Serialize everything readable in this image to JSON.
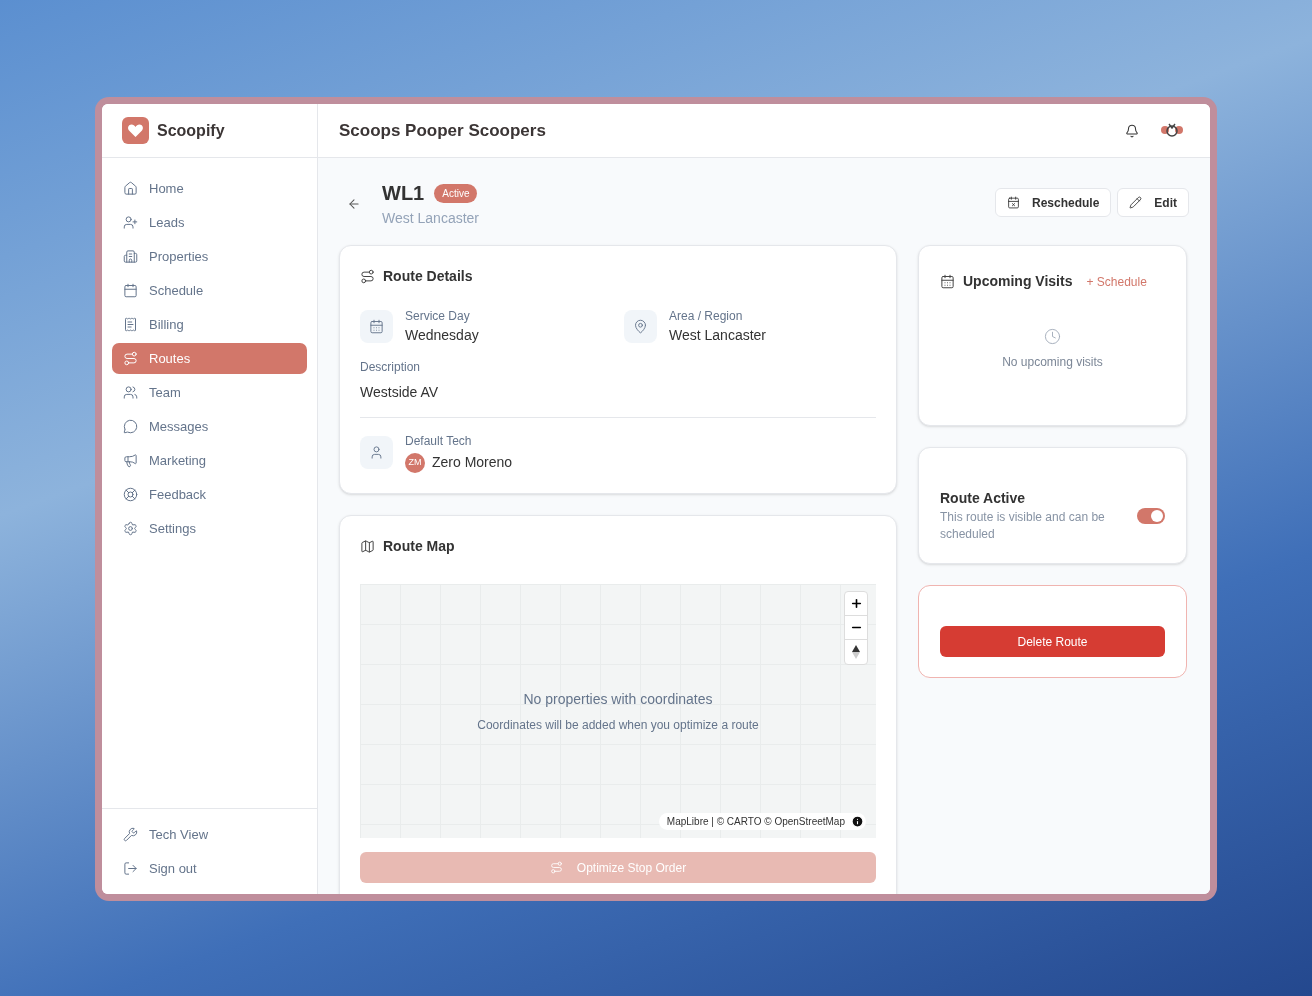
{
  "app": {
    "name": "Scoopify"
  },
  "sidebar": {
    "items": [
      {
        "label": "Home",
        "selected": false
      },
      {
        "label": "Leads",
        "selected": false
      },
      {
        "label": "Properties",
        "selected": false
      },
      {
        "label": "Schedule",
        "selected": false
      },
      {
        "label": "Billing",
        "selected": false
      },
      {
        "label": "Routes",
        "selected": true
      },
      {
        "label": "Team",
        "selected": false
      },
      {
        "label": "Messages",
        "selected": false
      },
      {
        "label": "Marketing",
        "selected": false
      },
      {
        "label": "Feedback",
        "selected": false
      },
      {
        "label": "Settings",
        "selected": false
      }
    ],
    "footer_items": [
      {
        "label": "Tech View"
      },
      {
        "label": "Sign out"
      }
    ]
  },
  "header": {
    "title": "Scoops Pooper Scoopers"
  },
  "page": {
    "title": "WL1",
    "status": "Active",
    "subtitle": "West Lancaster",
    "actions": [
      {
        "label": "Reschedule"
      },
      {
        "label": "Edit"
      }
    ]
  },
  "route_details": {
    "title": "Route Details",
    "service_day": {
      "label": "Service Day",
      "value": "Wednesday"
    },
    "area": {
      "label": "Area / Region",
      "value": "West Lancaster"
    },
    "description": {
      "label": "Description",
      "value": "Westside AV"
    },
    "default_tech": {
      "label": "Default Tech",
      "initials": "ZM",
      "name": "Zero Moreno"
    }
  },
  "route_map": {
    "title": "Route Map",
    "empty_title": "No properties with coordinates",
    "empty_hint": "Coordinates will be added when you optimize a route",
    "attribution": "MapLibre | © CARTO © OpenStreetMap",
    "optimize_button": {
      "label": "Optimize Stop Order",
      "disabled": true
    }
  },
  "upcoming_visits": {
    "title": "Upcoming Visits",
    "action": "+ Schedule",
    "empty": "No upcoming visits"
  },
  "route_active": {
    "title": "Route Active",
    "description": "This route is visible and can be scheduled",
    "on": true
  },
  "danger": {
    "button": "Delete Route"
  }
}
